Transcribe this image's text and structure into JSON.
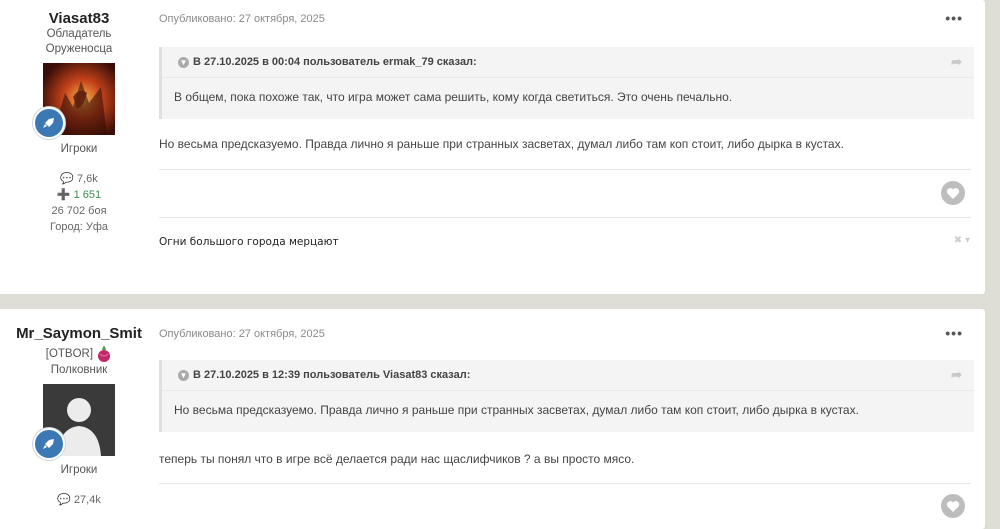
{
  "posts": [
    {
      "author": {
        "name": "Viasat83",
        "title_lines": [
          "Обладатель",
          "Оруженосца"
        ],
        "group": "Игроки",
        "stats": {
          "posts": "7,6k",
          "reputation": "1 651",
          "battles": "26 702 боя",
          "city": "Город: Уфа"
        }
      },
      "published": "Опубликовано: 27 октября, 2025",
      "quote": {
        "header": "В 27.10.2025 в 00:04 пользователь ermak_79 сказал:",
        "text": "В общем, пока похоже так, что игра может сама решить, кому когда светиться. Это очень печально."
      },
      "text": "Но весьма предсказуемо. Правда лично я раньше при странных засветах, думал либо там коп стоит, либо дырка в кустах.",
      "signature": "Огни большого города мерцают"
    },
    {
      "author": {
        "name": "Mr_Saymon_Smit",
        "clan": "[OTBOR]",
        "title_lines": [
          "Полковник"
        ],
        "group": "Игроки",
        "stats": {
          "posts": "27,4k"
        }
      },
      "published": "Опубликовано: 27 октября, 2025",
      "quote": {
        "header": "В 27.10.2025 в 12:39 пользователь Viasat83 сказал:",
        "text": "Но весьма предсказуемо. Правда лично я раньше при странных засветах, думал либо там коп стоит, либо дырка в кустах."
      },
      "text": "теперь ты понял что в игре всё делается ради нас щаслифчиков ? а вы просто мясо."
    }
  ],
  "icons": {
    "more": "ellipsis-icon",
    "quote_toggle": "chevron-down-icon",
    "quote_share": "share-arrow-icon",
    "like": "heart-icon",
    "posts": "comment-icon",
    "reputation": "plus-circle-icon",
    "rank": "rocket-icon",
    "signature_controls": "close-icon"
  },
  "colors": {
    "background": "#deddd6",
    "rank_badge": "#3b78b4",
    "reputation": "#3b8e4a",
    "like": "#bdbdbd"
  }
}
